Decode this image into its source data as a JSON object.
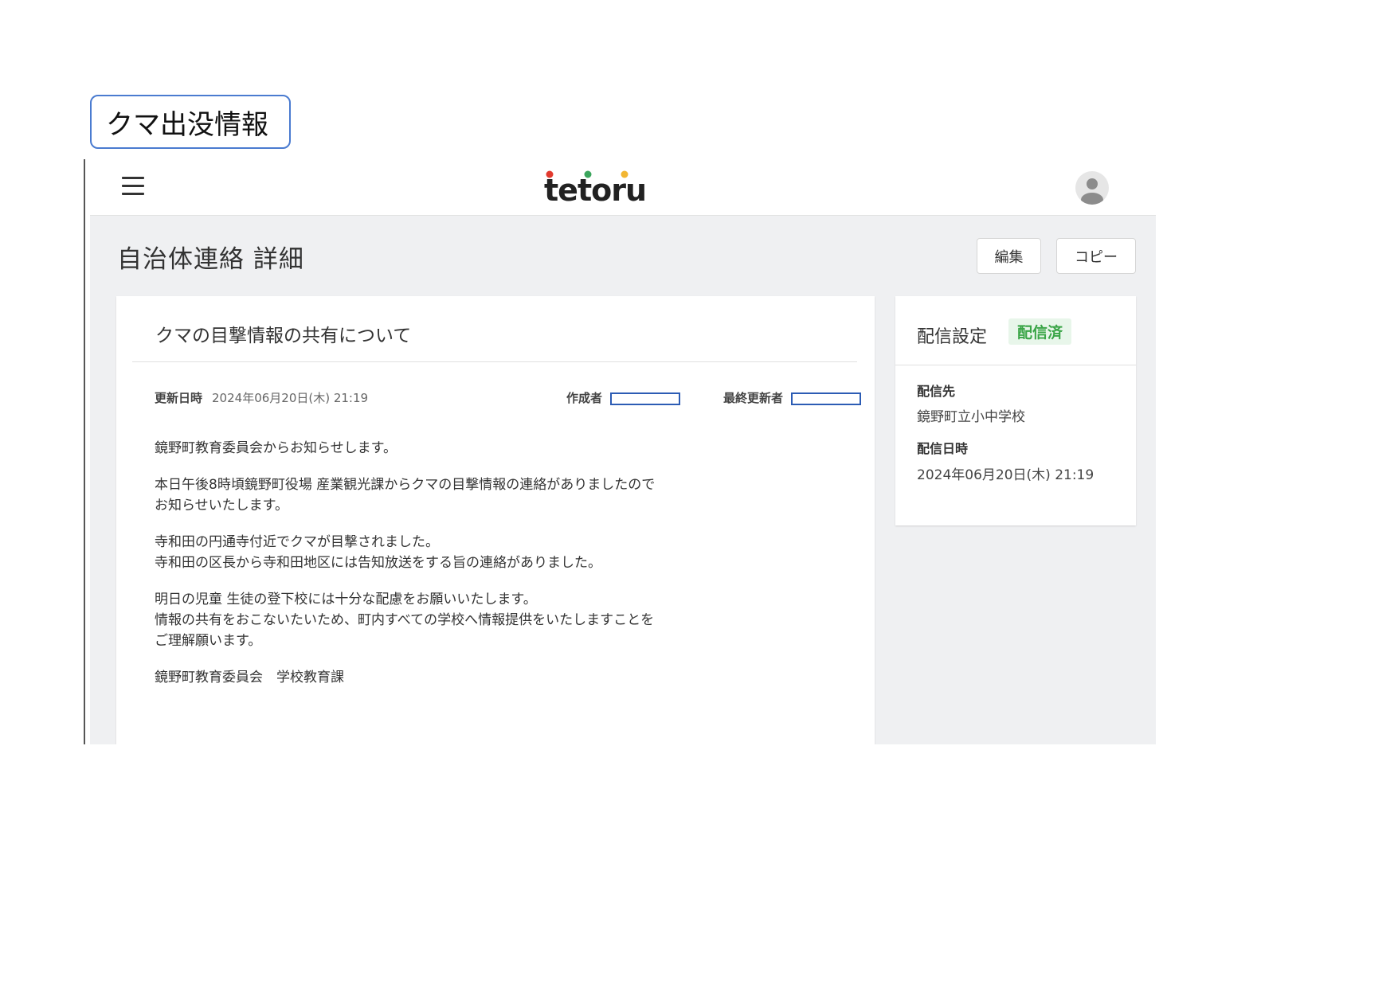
{
  "caption": "クマ出没情報",
  "brand": {
    "logo_text": "tetoru",
    "dot_colors": [
      "#e23a2e",
      "#3ba55c",
      "#f2b632"
    ]
  },
  "page": {
    "title": "自治体連絡 詳細",
    "edit_label": "編集",
    "copy_label": "コピー"
  },
  "message": {
    "subject": "クマの目撃情報の共有について",
    "updated_label": "更新日時",
    "updated_value": "2024年06月20日(木) 21:19",
    "author_label": "作成者",
    "editor_label": "最終更新者",
    "paragraphs": [
      [
        "鏡野町教育委員会からお知らせします。"
      ],
      [
        "本日午後8時頃鏡野町役場 産業観光課からクマの目撃情報の連絡がありましたので",
        "お知らせいたします。"
      ],
      [
        "寺和田の円通寺付近でクマが目撃されました。",
        "寺和田の区長から寺和田地区には告知放送をする旨の連絡がありました。"
      ],
      [
        "明日の児童 生徒の登下校には十分な配慮をお願いいたします。",
        "情報の共有をおこないたいため、町内すべての学校へ情報提供をいたしますことを",
        "ご理解願います。"
      ],
      [
        "鏡野町教育委員会　学校教育課"
      ]
    ]
  },
  "delivery": {
    "title": "配信設定",
    "status": "配信済",
    "status_color": "#3aa547",
    "destination_label": "配信先",
    "destination_value": "鏡野町立小中学校",
    "datetime_label": "配信日時",
    "datetime_value": "2024年06月20日(木) 21:19"
  },
  "icons": {
    "menu": "hamburger-menu-icon",
    "user": "user-avatar-icon"
  }
}
